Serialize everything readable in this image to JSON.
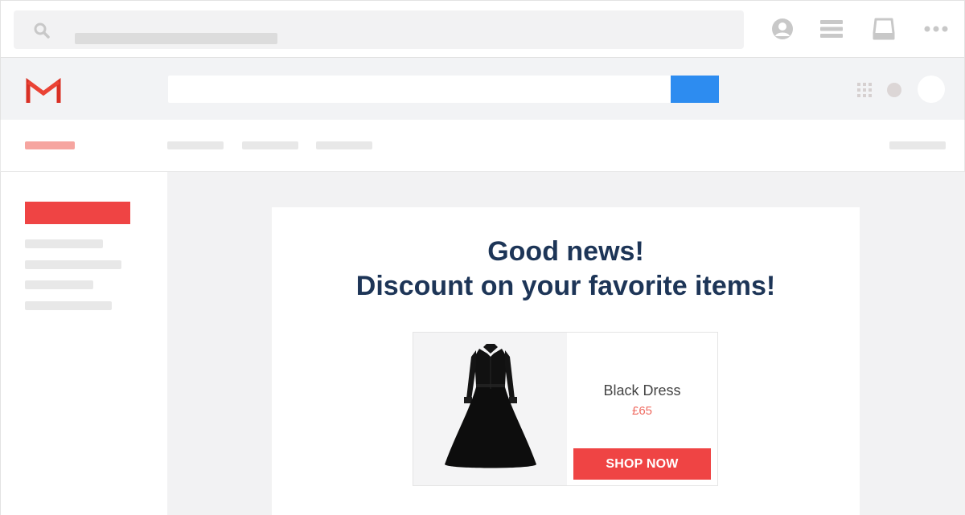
{
  "browser": {
    "icons": [
      "search-icon",
      "user-icon",
      "menu-icon",
      "inbox-icon",
      "more-icon"
    ]
  },
  "gmail": {
    "logo_icon": "gmail-logo",
    "colors": {
      "search_button": "#2d8cf0",
      "brand_red": "#ef4444",
      "heading": "#1d3557"
    }
  },
  "email": {
    "headline_line1": "Good news!",
    "headline_line2": "Discount on your favorite items!",
    "product": {
      "name": "Black Dress",
      "price": "£65",
      "cta": "SHOP NOW",
      "image_icon": "black-dress-image"
    }
  }
}
